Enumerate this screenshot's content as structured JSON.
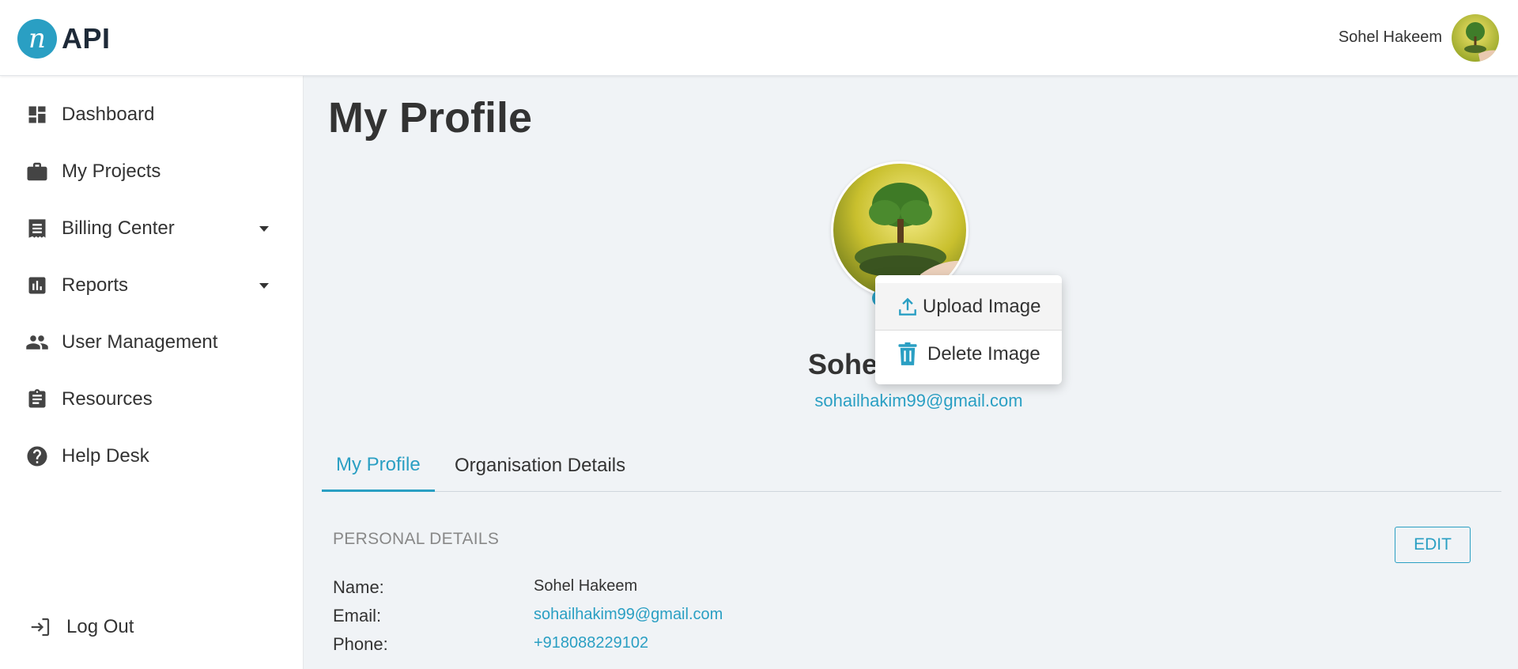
{
  "header": {
    "logo_mark": "n",
    "logo_text": "API",
    "user_name": "Sohel Hakeem"
  },
  "sidebar": {
    "items": [
      {
        "label": "Dashboard",
        "icon": "dashboard-icon"
      },
      {
        "label": "My Projects",
        "icon": "briefcase-icon"
      },
      {
        "label": "Billing Center",
        "icon": "receipt-icon",
        "has_dropdown": true
      },
      {
        "label": "Reports",
        "icon": "bar-chart-icon",
        "has_dropdown": true
      },
      {
        "label": "User Management",
        "icon": "people-icon"
      },
      {
        "label": "Resources",
        "icon": "clipboard-icon"
      },
      {
        "label": "Help Desk",
        "icon": "help-icon"
      }
    ],
    "logout_label": "Log Out"
  },
  "main": {
    "page_title": "My Profile",
    "profile_name": "Sohel",
    "profile_email": "sohailhakim99@gmail.com",
    "photo_menu": {
      "upload_label": "Upload Image",
      "delete_label": "Delete Image"
    },
    "tabs": [
      {
        "label": "My Profile",
        "active": true
      },
      {
        "label": "Organisation Details",
        "active": false
      }
    ],
    "section_title": "PERSONAL DETAILS",
    "edit_label": "EDIT",
    "details": [
      {
        "label": "Name:",
        "value": "Sohel Hakeem"
      },
      {
        "label": "Email:",
        "value": "sohailhakim99@gmail.com"
      },
      {
        "label": "Phone:",
        "value": "+918088229102"
      }
    ]
  },
  "colors": {
    "accent": "#2a9fc3",
    "background": "#f0f3f6",
    "text": "#333333"
  }
}
